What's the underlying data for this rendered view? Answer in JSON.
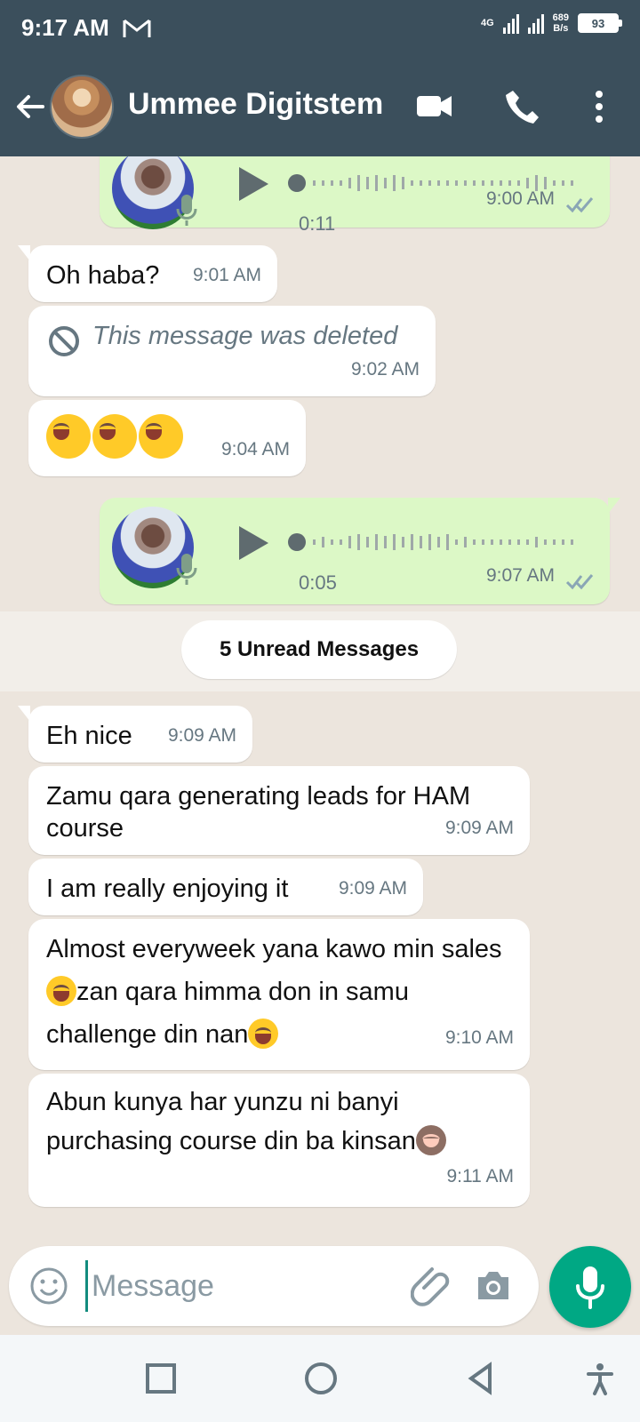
{
  "status_bar": {
    "time": "9:17 AM",
    "network": "4G",
    "speed_value": "689",
    "speed_unit": "B/s",
    "battery": "93"
  },
  "header": {
    "contact_name": "Ummee Digitstem",
    "icons": [
      "back-arrow-icon",
      "video-call-icon",
      "phone-icon",
      "more-options-icon"
    ]
  },
  "messages": [
    {
      "type": "voice",
      "direction": "outgoing",
      "duration": "0:11",
      "time": "9:00 AM",
      "status": "read"
    },
    {
      "type": "text",
      "direction": "incoming",
      "text": "Oh haba?",
      "time": "9:01 AM"
    },
    {
      "type": "deleted",
      "direction": "incoming",
      "text": "This message was deleted",
      "time": "9:02 AM"
    },
    {
      "type": "emoji",
      "direction": "incoming",
      "emojis": [
        "rolling-on-floor-laughing",
        "rolling-on-floor-laughing",
        "rolling-on-floor-laughing"
      ],
      "time": "9:04 AM"
    },
    {
      "type": "voice",
      "direction": "outgoing",
      "duration": "0:05",
      "time": "9:07 AM",
      "status": "read"
    }
  ],
  "unread_separator": "5 Unread Messages",
  "unread_messages": [
    {
      "text": "Eh nice",
      "time": "9:09 AM"
    },
    {
      "text": "Zamu qara generating leads for HAM course",
      "time": "9:09 AM"
    },
    {
      "text": "I am really enjoying it",
      "time": "9:09 AM"
    },
    {
      "text_parts": [
        "Almost everyweek yana kawo min sales",
        "zan qara himma don in samu challenge din nan"
      ],
      "emoji_after_parts": [
        "rolling-on-floor-laughing",
        "face-with-tears-of-joy"
      ],
      "time": "9:10 AM"
    },
    {
      "text_parts": [
        "Abun kunya har yunzu ni banyi purchasing course din ba kinsan"
      ],
      "emoji_after_parts": [
        "see-no-evil-monkey"
      ],
      "time": "9:11 AM"
    }
  ],
  "composer": {
    "placeholder": "Message",
    "value": ""
  },
  "colors": {
    "header": "#3b4f5c",
    "background": "#ece5dd",
    "outgoing": "#dcf8c6",
    "accent": "#00a884"
  }
}
